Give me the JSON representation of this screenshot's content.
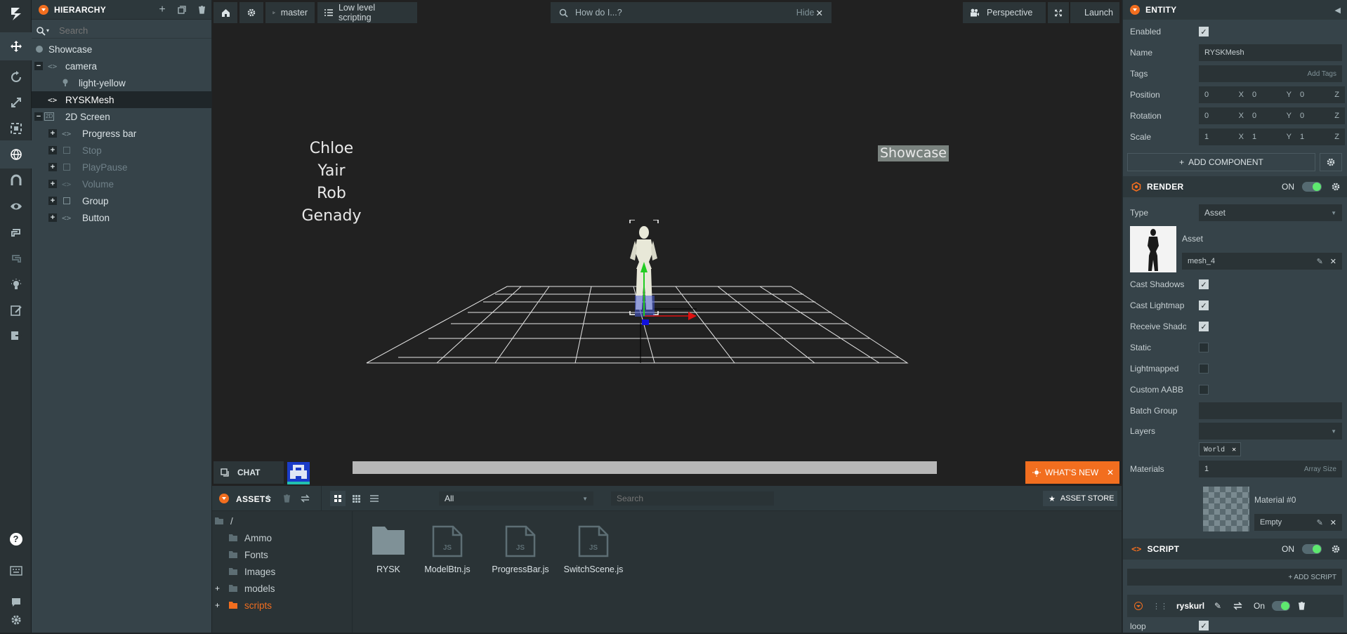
{
  "hierarchy": {
    "title": "HIERARCHY",
    "search_placeholder": "Search",
    "items": [
      {
        "label": "Showcase"
      },
      {
        "label": "camera"
      },
      {
        "label": "light-yellow"
      },
      {
        "label": "RYSKMesh"
      },
      {
        "label": "2D Screen"
      },
      {
        "label": "Progress bar"
      },
      {
        "label": "Stop"
      },
      {
        "label": "PlayPause"
      },
      {
        "label": "Volume"
      },
      {
        "label": "Group"
      },
      {
        "label": "Button"
      }
    ],
    "badge_2d": "2D"
  },
  "viewport": {
    "branch": "master",
    "scene_name": "Low level scripting",
    "help_placeholder": "How do I...?",
    "hide_label": "Hide",
    "camera_mode": "Perspective",
    "launch_label": "Launch",
    "names": [
      "Chloe",
      "Yair",
      "Rob",
      "Genady"
    ],
    "showcase_label": "Showcase",
    "chat_label": "CHAT",
    "whats_new_label": "WHAT'S NEW"
  },
  "assets": {
    "title": "ASSETS",
    "filter": "All",
    "search_placeholder": "Search",
    "store_label": "ASSET STORE",
    "root": "/",
    "folders": [
      "Ammo",
      "Fonts",
      "Images",
      "models",
      "scripts"
    ],
    "files": [
      {
        "name": "RYSK",
        "kind": "folder"
      },
      {
        "name": "ModelBtn.js",
        "kind": "js"
      },
      {
        "name": "ProgressBar.js",
        "kind": "js"
      },
      {
        "name": "SwitchScene.js",
        "kind": "js"
      }
    ],
    "js_badge": "JS"
  },
  "inspector": {
    "title": "ENTITY",
    "enabled_label": "Enabled",
    "name_label": "Name",
    "name_value": "RYSKMesh",
    "tags_label": "Tags",
    "add_tags": "Add Tags",
    "position_label": "Position",
    "rotation_label": "Rotation",
    "scale_label": "Scale",
    "position": [
      "0",
      "0",
      "0"
    ],
    "rotation": [
      "0",
      "0",
      "0"
    ],
    "scale": [
      "1",
      "1",
      "1"
    ],
    "axes": [
      "X",
      "Y",
      "Z"
    ],
    "add_component": "ADD COMPONENT",
    "render": {
      "title": "RENDER",
      "on_label": "ON",
      "type_label": "Type",
      "type_value": "Asset",
      "asset_label": "Asset",
      "asset_value": "mesh_4",
      "cast_shadows": "Cast Shadows",
      "cast_lightmap": "Cast Lightmap ...",
      "receive_shadows": "Receive Shado...",
      "static": "Static",
      "lightmapped": "Lightmapped",
      "custom_aabb": "Custom AABB",
      "batch_group": "Batch Group",
      "layers": "Layers",
      "layer_tag": "World",
      "materials": "Materials",
      "materials_count": "1",
      "array_size": "Array Size",
      "material_name": "Material #0",
      "material_value": "Empty"
    },
    "script": {
      "title": "SCRIPT",
      "on_label": "ON",
      "add_script": "+ ADD SCRIPT",
      "script_name": "ryskurl",
      "script_on": "On",
      "loop_label": "loop"
    }
  }
}
